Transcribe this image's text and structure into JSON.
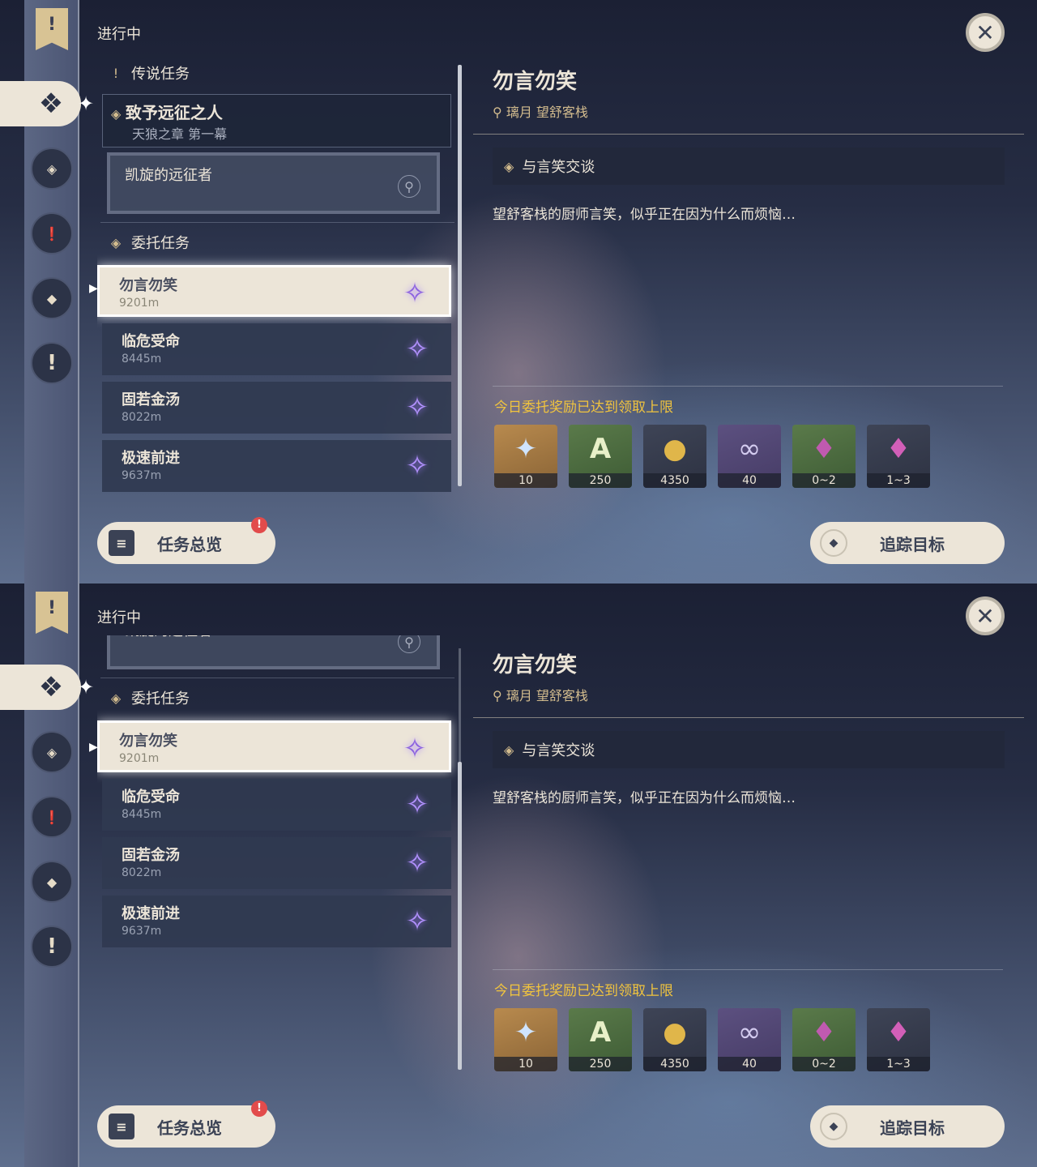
{
  "header": {
    "in_progress": "进行中",
    "close_symbol": "✕"
  },
  "categories": {
    "legend": "传说任务",
    "commission": "委托任务"
  },
  "legend_quest": {
    "name": "致予远征之人",
    "chapter": "天狼之章 第一幕",
    "sub_quest": "凯旋的远征者"
  },
  "commissions": [
    {
      "name": "勿言勿笑",
      "distance": "9201m"
    },
    {
      "name": "临危受命",
      "distance": "8445m"
    },
    {
      "name": "固若金汤",
      "distance": "8022m"
    },
    {
      "name": "极速前进",
      "distance": "9637m"
    }
  ],
  "detail": {
    "title": "勿言勿笑",
    "location": "璃月 望舒客栈",
    "step": "与言笑交谈",
    "description": "望舒客栈的厨师言笑，似乎正在因为什么而烦恼…"
  },
  "rewards": {
    "title": "今日委托奖励已达到领取上限",
    "items": [
      {
        "icon": "primogem-icon",
        "count": "10"
      },
      {
        "icon": "adventure-exp-icon",
        "count": "250"
      },
      {
        "icon": "mora-icon",
        "count": "4350"
      },
      {
        "icon": "friendship-exp-icon",
        "count": "40"
      },
      {
        "icon": "crystal-chunk-icon",
        "count": "0~2"
      },
      {
        "icon": "crystal-cluster-icon",
        "count": "1~3"
      }
    ]
  },
  "buttons": {
    "overview": "任务总览",
    "badge": "!",
    "track": "追踪目标"
  },
  "colors": {
    "accent_gold": "#d3bc8e",
    "reward_yellow": "#f1c43e",
    "selected_bg": "#ece5d8",
    "quest_purple": "#b392ff"
  }
}
